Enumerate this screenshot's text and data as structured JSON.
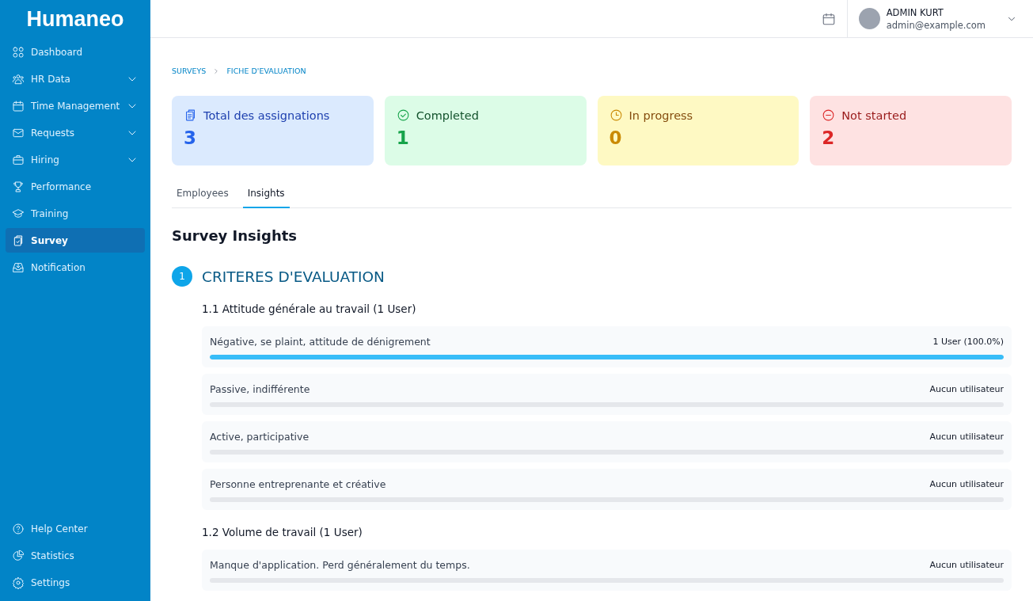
{
  "sidebar": {
    "logo": "Humaneo",
    "items": [
      {
        "label": "Dashboard",
        "expandable": false,
        "selected": false
      },
      {
        "label": "HR Data",
        "expandable": true,
        "selected": false
      },
      {
        "label": "Time Management",
        "expandable": true,
        "selected": false
      },
      {
        "label": "Requests",
        "expandable": true,
        "selected": false
      },
      {
        "label": "Hiring",
        "expandable": true,
        "selected": false
      },
      {
        "label": "Performance",
        "expandable": false,
        "selected": false
      },
      {
        "label": "Training",
        "expandable": false,
        "selected": false
      },
      {
        "label": "Survey",
        "expandable": false,
        "selected": true
      },
      {
        "label": "Notification",
        "expandable": false,
        "selected": false
      }
    ],
    "bottom_items": [
      {
        "label": "Help Center"
      },
      {
        "label": "Statistics"
      },
      {
        "label": "Settings"
      }
    ]
  },
  "header": {
    "user_name": "ADMIN KURT",
    "user_email": "admin@example.com"
  },
  "breadcrumb": [
    "SURVEYS",
    "FICHE D'EVALUATION"
  ],
  "stats": [
    {
      "kind": "total",
      "label": "Total des assignations",
      "value": "3"
    },
    {
      "kind": "completed",
      "label": "Completed",
      "value": "1"
    },
    {
      "kind": "in_progress",
      "label": "In progress",
      "value": "0"
    },
    {
      "kind": "not_started",
      "label": "Not started",
      "value": "2"
    }
  ],
  "tabs": [
    {
      "label": "Employees",
      "selected": false
    },
    {
      "label": "Insights",
      "selected": true
    }
  ],
  "insights": {
    "title": "Survey Insights",
    "sections": [
      {
        "number": "1",
        "title": "CRITERES D'EVALUATION",
        "questions": [
          {
            "title": "1.1 Attitude générale au travail (1 User)",
            "options": [
              {
                "label": "Négative, se plaint, attitude de dénigrement",
                "reading": "1 User (100.0%)",
                "level": 1
              },
              {
                "label": "Passive, indifférente",
                "reading": "Aucun utilisateur",
                "level": 0
              },
              {
                "label": "Active, participative",
                "reading": "Aucun utilisateur",
                "level": 0
              },
              {
                "label": "Personne entreprenante et créative",
                "reading": "Aucun utilisateur",
                "level": 0
              }
            ]
          },
          {
            "title": "1.2 Volume de travail (1 User)",
            "options": [
              {
                "label": "Manque d'application. Perd généralement du temps.",
                "reading": "Aucun utilisateur",
                "level": 0
              }
            ]
          }
        ]
      }
    ]
  }
}
